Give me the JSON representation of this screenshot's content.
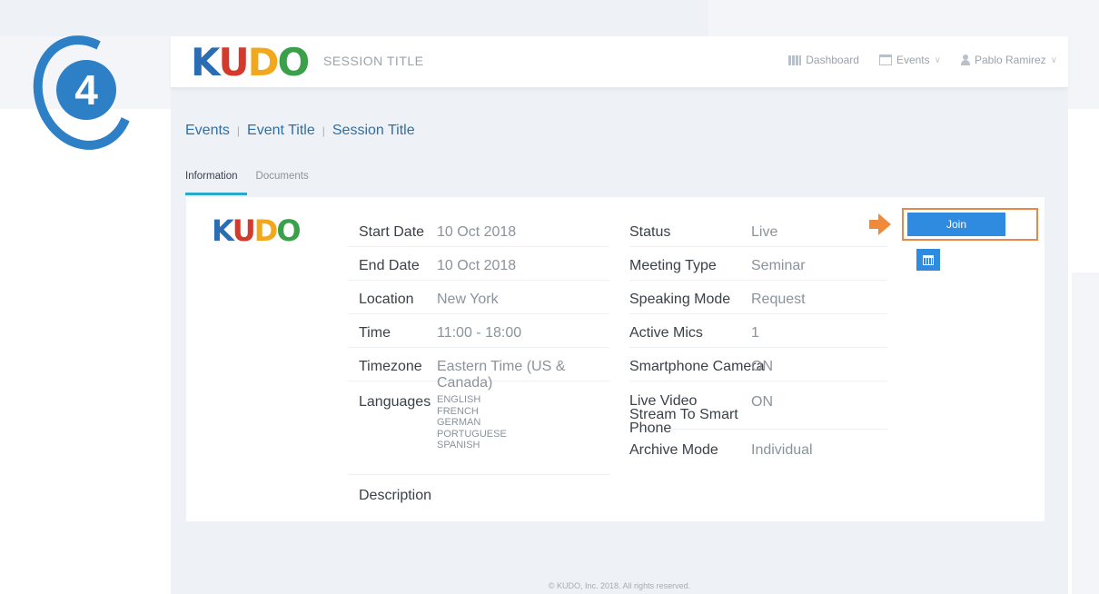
{
  "step_number": "4",
  "brand": {
    "logo_letters": [
      {
        "char": "K",
        "color": "#2b6db5"
      },
      {
        "char": "U",
        "color": "#d33a2c"
      },
      {
        "char": "D",
        "color": "#f2a81d"
      },
      {
        "char": "O",
        "color": "#3aa14a"
      }
    ]
  },
  "header": {
    "session_title": "SESSION TITLE",
    "nav": {
      "dashboard": "Dashboard",
      "events": "Events",
      "user": "Pablo Ramirez"
    }
  },
  "breadcrumb": {
    "events": "Events",
    "event_title": "Event Title",
    "session_title": "Session Title",
    "separator": "|"
  },
  "tabs": {
    "information": "Information",
    "documents": "Documents"
  },
  "details_left": [
    {
      "label": "Start Date",
      "value": "10 Oct 2018"
    },
    {
      "label": "End Date",
      "value": "10 Oct 2018"
    },
    {
      "label": "Location",
      "value": "New York"
    },
    {
      "label": "Time",
      "value": "11:00 - 18:00"
    },
    {
      "label": "Timezone",
      "value": "Eastern Time (US & Canada)"
    },
    {
      "label": "Languages",
      "value": "ENGLISH\nFRENCH\nGERMAN\nPORTUGUESE\nSPANISH"
    },
    {
      "label": "Description",
      "value": ""
    }
  ],
  "details_right": [
    {
      "label": "Status",
      "value": "Live"
    },
    {
      "label": "Meeting Type",
      "value": "Seminar"
    },
    {
      "label": "Speaking Mode",
      "value": "Request"
    },
    {
      "label": "Active Mics",
      "value": "1"
    },
    {
      "label": "Smartphone Camera",
      "value": "ON"
    },
    {
      "label": "Live Video Stream To Smart Phone",
      "value": "ON"
    },
    {
      "label": "Archive Mode",
      "value": "Individual"
    }
  ],
  "actions": {
    "join_label": "Join"
  },
  "footer": {
    "text": "© KUDO, Inc. 2018. All rights reserved."
  },
  "colors": {
    "accent_blue": "#2f8be0",
    "highlight_orange": "#e8894a",
    "tab_underline": "#2aa7c9"
  }
}
